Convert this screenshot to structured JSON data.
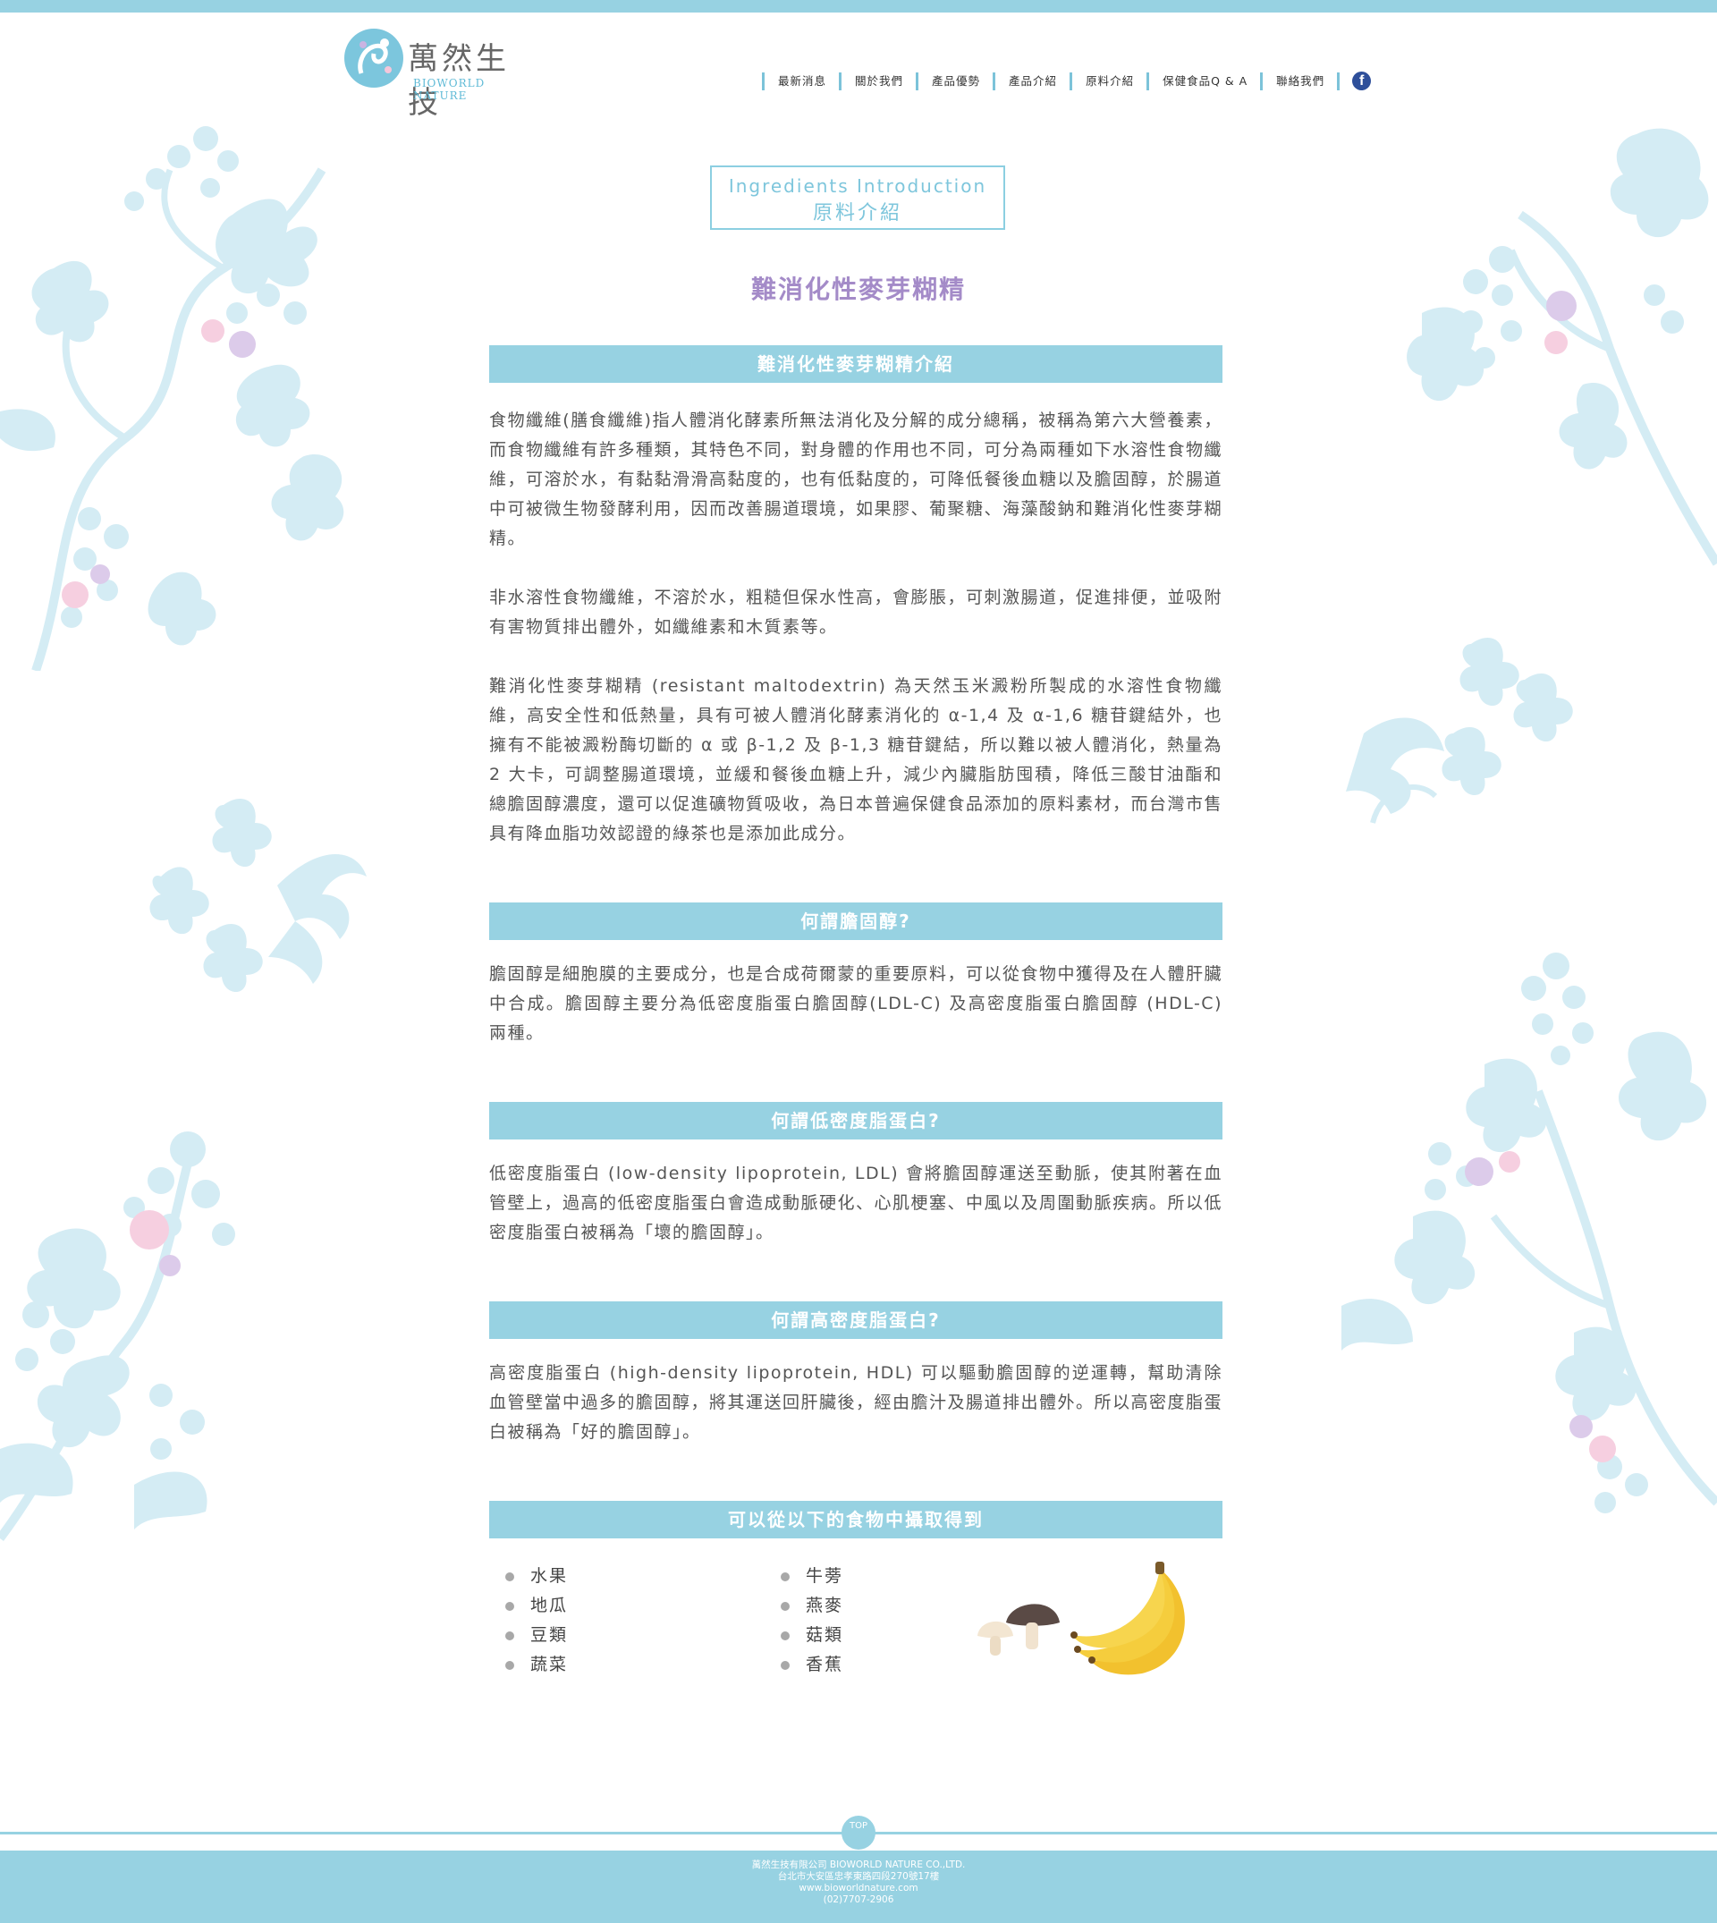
{
  "brand": {
    "name_cn": "萬然生技",
    "name_en": "BIOWORLD NATURE"
  },
  "nav": {
    "items": [
      "最新消息",
      "關於我們",
      "產品優勢",
      "產品介紹",
      "原料介紹",
      "保健食品Q & A",
      "聯絡我們"
    ],
    "social_icon": "facebook-icon"
  },
  "page_heading": {
    "en": "Ingredients Introduction",
    "cn": "原料介紹"
  },
  "product_title": "難消化性麥芽糊精",
  "sections": [
    {
      "heading": "難消化性麥芽糊精介紹",
      "paragraphs": [
        "食物纖維(膳食纖維)指人體消化酵素所無法消化及分解的成分總稱，被稱為第六大營養素，而食物纖維有許多種類，其特色不同，對身體的作用也不同，可分為兩種如下水溶性食物纖維，可溶於水，有黏黏滑滑高黏度的，也有低黏度的，可降低餐後血糖以及膽固醇，於腸道中可被微生物發酵利用，因而改善腸道環境，如果膠、葡聚糖、海藻酸鈉和難消化性麥芽糊精。",
        "非水溶性食物纖維，不溶於水，粗糙但保水性高，會膨脹，可刺激腸道，促進排便，並吸附有害物質排出體外，如纖維素和木質素等。",
        "難消化性麥芽糊精 (resistant maltodextrin) 為天然玉米澱粉所製成的水溶性食物纖維，高安全性和低熱量，具有可被人體消化酵素消化的 α-1,4 及 α-1,6 糖苷鍵結外，也擁有不能被澱粉酶切斷的 α 或 β-1,2 及 β-1,3 糖苷鍵結，所以難以被人體消化，熱量為 2 大卡，可調整腸道環境，並緩和餐後血糖上升，減少內臟脂肪囤積，降低三酸甘油酯和總膽固醇濃度，還可以促進礦物質吸收，為日本普遍保健食品添加的原料素材，而台灣市售具有降血脂功效認證的綠茶也是添加此成分。"
      ]
    },
    {
      "heading": "何謂膽固醇?",
      "paragraphs": [
        "膽固醇是細胞膜的主要成分，也是合成荷爾蒙的重要原料，可以從食物中獲得及在人體肝臟中合成。膽固醇主要分為低密度脂蛋白膽固醇(LDL-C) 及高密度脂蛋白膽固醇 (HDL-C) 兩種。"
      ]
    },
    {
      "heading": "何謂低密度脂蛋白?",
      "paragraphs": [
        "低密度脂蛋白 (low-density lipoprotein, LDL) 會將膽固醇運送至動脈，使其附著在血管壁上，過高的低密度脂蛋白會造成動脈硬化、心肌梗塞、中風以及周圍動脈疾病。所以低密度脂蛋白被稱為「壞的膽固醇」。"
      ]
    },
    {
      "heading": "何謂高密度脂蛋白?",
      "paragraphs": [
        "高密度脂蛋白 (high-density lipoprotein, HDL) 可以驅動膽固醇的逆運轉，幫助清除血管壁當中過多的膽固醇，將其運送回肝臟後，經由膽汁及腸道排出體外。所以高密度脂蛋白被稱為「好的膽固醇」。"
      ]
    },
    {
      "heading": "可以從以下的食物中攝取得到",
      "paragraphs": []
    }
  ],
  "foods": {
    "col1": [
      "水果",
      "地瓜",
      "豆類",
      "蔬菜"
    ],
    "col2": [
      "牛蒡",
      "燕麥",
      "菇類",
      "香蕉"
    ],
    "images": [
      "mushroom-icon",
      "banana-icon"
    ]
  },
  "top_button": "TOP",
  "footer": {
    "company": "萬然生技有限公司 BIOWORLD NATURE CO.,LTD.",
    "address": "台北市大安區忠孝東路四段270號17樓",
    "website": "www.bioworldnature.com",
    "phone": "(02)7707-2906"
  },
  "colors": {
    "accent": "#97d2e2",
    "title_purple": "#a48bc8",
    "floral": "#d4ecf4",
    "dot_pink": "#f6cfe0",
    "dot_purple": "#dccbea",
    "facebook": "#2e4f9a"
  }
}
